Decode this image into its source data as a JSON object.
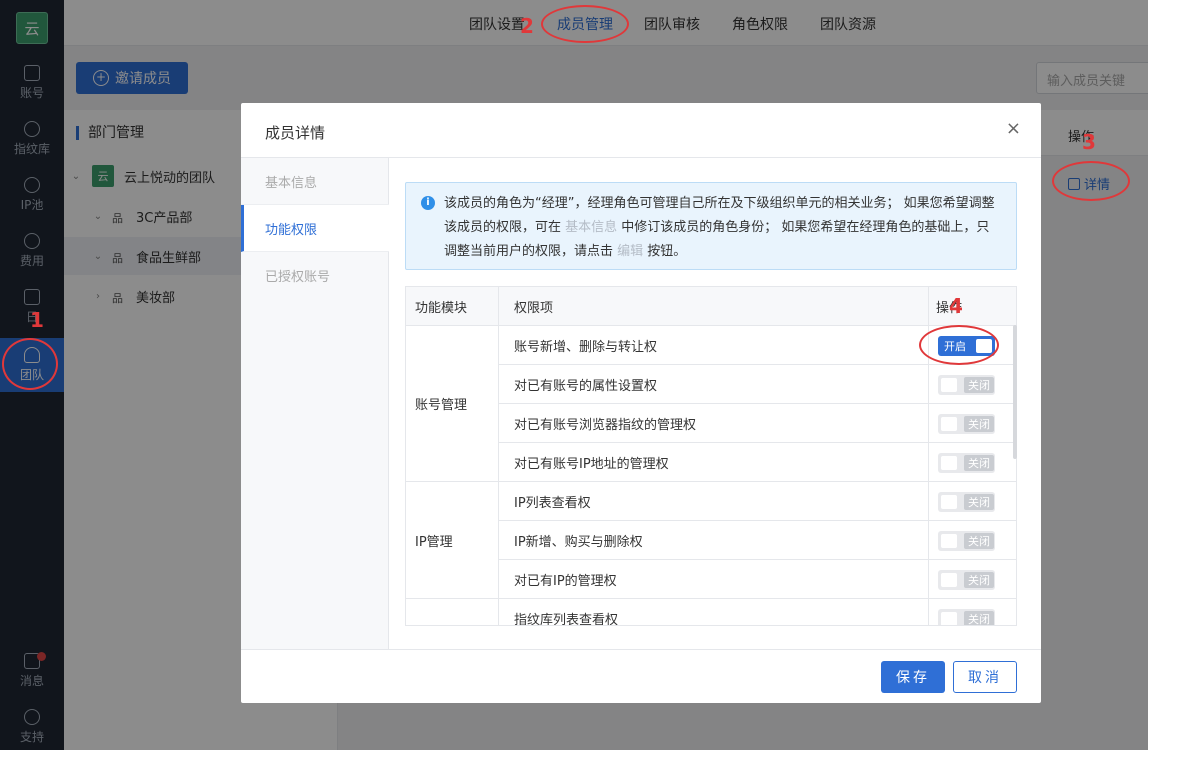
{
  "sidebar": {
    "logo_text": "云",
    "items": [
      {
        "label": "账号",
        "icon": "id-card-icon"
      },
      {
        "label": "指纹库",
        "icon": "fingerprint-icon"
      },
      {
        "label": "IP池",
        "icon": "ip-icon"
      },
      {
        "label": "费用",
        "icon": "yen-icon"
      },
      {
        "label": "日",
        "icon": "log-icon"
      },
      {
        "label": "团队",
        "icon": "team-icon",
        "active": true
      },
      {
        "label": "消息",
        "icon": "mail-icon"
      },
      {
        "label": "支持",
        "icon": "headset-icon"
      }
    ]
  },
  "top_tabs": [
    "团队设置",
    "成员管理",
    "团队审核",
    "角色权限",
    "团队资源"
  ],
  "toolbar": {
    "invite_label": "邀请成员",
    "search_placeholder": "输入成员关键"
  },
  "dept": {
    "title": "部门管理",
    "team_icon_text": "云",
    "team_name": "云上悦动的团队",
    "departments": [
      "3C产品部",
      "食品生鲜部",
      "美妆部"
    ]
  },
  "member_table": {
    "op_header": "操作",
    "detail_link": "详情"
  },
  "modal": {
    "title": "成员详情",
    "close": "×",
    "nav": [
      "基本信息",
      "功能权限",
      "已授权账号"
    ],
    "info": {
      "icon": "i",
      "part1": "该成员的角色为“经理”，经理角色可管理自己所在及下级组织单元的相关业务； 如果您希望调整该成员的权限，可在 ",
      "link1": "基本信息",
      "part2": " 中修订该成员的角色身份； 如果您希望在经理角色的基础上，只调整当前用户的权限，请点击 ",
      "link2": "编辑",
      "part3": " 按钮。"
    },
    "table_headers": [
      "功能模块",
      "权限项",
      "操作"
    ],
    "modules": [
      {
        "name": "账号管理",
        "perms": [
          {
            "label": "账号新增、删除与转让权",
            "state": "开启",
            "on": true
          },
          {
            "label": "对已有账号的属性设置权",
            "state": "关闭",
            "on": false
          },
          {
            "label": "对已有账号浏览器指纹的管理权",
            "state": "关闭",
            "on": false
          },
          {
            "label": "对已有账号IP地址的管理权",
            "state": "关闭",
            "on": false
          }
        ]
      },
      {
        "name": "IP管理",
        "perms": [
          {
            "label": "IP列表查看权",
            "state": "关闭",
            "on": false
          },
          {
            "label": "IP新增、购买与删除权",
            "state": "关闭",
            "on": false
          },
          {
            "label": "对已有IP的管理权",
            "state": "关闭",
            "on": false
          }
        ]
      },
      {
        "name": "",
        "perms": [
          {
            "label": "指纹库列表查看权",
            "state": "关闭",
            "on": false
          }
        ]
      }
    ],
    "save_label": "保存",
    "cancel_label": "取消"
  },
  "annotations": [
    "1",
    "2",
    "3",
    "4"
  ],
  "colors": {
    "accent": "#2f6fd6",
    "sidebar_bg": "#1f2733",
    "annotation_red": "#e0383a",
    "brand_green": "#3c9f6d"
  }
}
